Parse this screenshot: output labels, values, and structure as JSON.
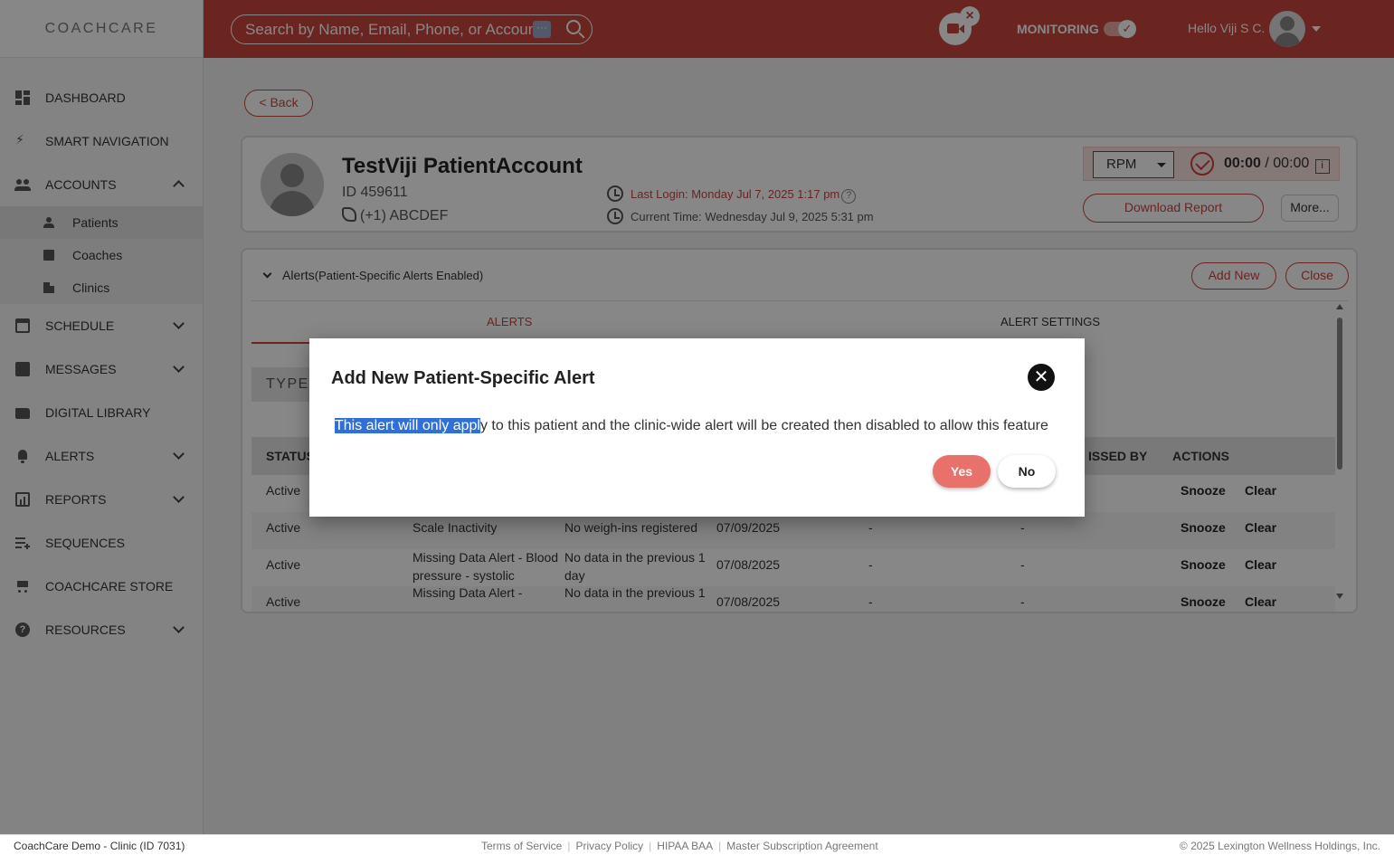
{
  "logo": {
    "text": "COACHCARE"
  },
  "search": {
    "placeholder": "Search by Name, Email, Phone, or Account ID",
    "dots": "···"
  },
  "header": {
    "video_close": "×",
    "monitoring_label": "MONITORING",
    "toggle_check": "✓",
    "greeting": "Hello Viji S C."
  },
  "sidebar": {
    "items": [
      {
        "label": "DASHBOARD",
        "icon": "dashboard-icon"
      },
      {
        "label": "SMART NAVIGATION",
        "icon": "bolt-icon"
      },
      {
        "label": "ACCOUNTS",
        "icon": "people-icon",
        "expanded": true
      },
      {
        "label": "SCHEDULE",
        "icon": "calendar-icon"
      },
      {
        "label": "MESSAGES",
        "icon": "message-icon"
      },
      {
        "label": "DIGITAL LIBRARY",
        "icon": "folder-icon"
      },
      {
        "label": "ALERTS",
        "icon": "bell-icon"
      },
      {
        "label": "REPORTS",
        "icon": "report-icon"
      },
      {
        "label": "SEQUENCES",
        "icon": "playlist-icon"
      },
      {
        "label": "COACHCARE STORE",
        "icon": "cart-icon"
      },
      {
        "label": "RESOURCES",
        "icon": "help-icon"
      }
    ],
    "accounts_sub": [
      {
        "label": "Patients",
        "icon": "person-icon",
        "active": true
      },
      {
        "label": "Coaches",
        "icon": "badge-icon"
      },
      {
        "label": "Clinics",
        "icon": "building-icon"
      }
    ]
  },
  "main": {
    "back_label": "< Back",
    "patient": {
      "name": "TestViji PatientAccount",
      "id": "ID 459611",
      "phone": "(+1) ABCDEF",
      "last_login": "Last Login: Monday Jul 7, 2025 1:17 pm",
      "current_time": "Current Time: Wednesday Jul 9, 2025 5:31 pm",
      "help_mark": "?"
    },
    "rpm": {
      "program": "RPM",
      "timer_elapsed": "00:00",
      "timer_total": "/ 00:00",
      "info_mark": "i",
      "download_label": "Download Report",
      "more_label": "More..."
    },
    "alerts": {
      "title": "Alerts",
      "subtitle": "(Patient-Specific Alerts Enabled)",
      "add_new_label": "Add New",
      "close_label": "Close",
      "tabs": [
        "ALERTS",
        "ALERT SETTINGS"
      ],
      "active_tab": "ALERTS",
      "type_label": "TYPE:",
      "columns": [
        "STATUS",
        "ISSED BY",
        "ACTIONS"
      ],
      "rows": [
        {
          "status": "Active",
          "type": "",
          "detail": "",
          "date": "",
          "col5": "",
          "col6": "",
          "snooze": "Snooze",
          "clear": "Clear"
        },
        {
          "status": "Active",
          "type": "Scale Inactivity",
          "detail": "No weigh-ins registered",
          "date": "07/09/2025",
          "col5": "-",
          "col6": "-",
          "snooze": "Snooze",
          "clear": "Clear"
        },
        {
          "status": "Active",
          "type": "Missing Data Alert - Blood pressure - systolic",
          "detail": "No data in the previous 1 day",
          "date": "07/08/2025",
          "col5": "-",
          "col6": "-",
          "snooze": "Snooze",
          "clear": "Clear"
        },
        {
          "status": "Active",
          "type": "Missing Data Alert -",
          "detail": "No data in the previous 1",
          "date": "07/08/2025",
          "col5": "-",
          "col6": "-",
          "snooze": "Snooze",
          "clear": "Clear"
        }
      ]
    }
  },
  "modal": {
    "title": "Add New Patient-Specific Alert",
    "close_mark": "✕",
    "text_highlighted": "This alert will only appl",
    "text_rest": "y to this patient and the clinic-wide alert will be created then disabled to allow this feature",
    "yes_label": "Yes",
    "no_label": "No"
  },
  "footer": {
    "clinic": "CoachCare Demo - Clinic (ID 7031)",
    "links": [
      "Terms of Service",
      "Privacy Policy",
      "HIPAA BAA",
      "Master Subscription Agreement"
    ],
    "copyright": "© 2025 Lexington Wellness Holdings, Inc."
  },
  "colors": {
    "brand": "#c8463f",
    "overlay": "rgba(0,0,0,0.47)",
    "yes_button": "#e8716b",
    "selection": "#2f6fd6"
  }
}
